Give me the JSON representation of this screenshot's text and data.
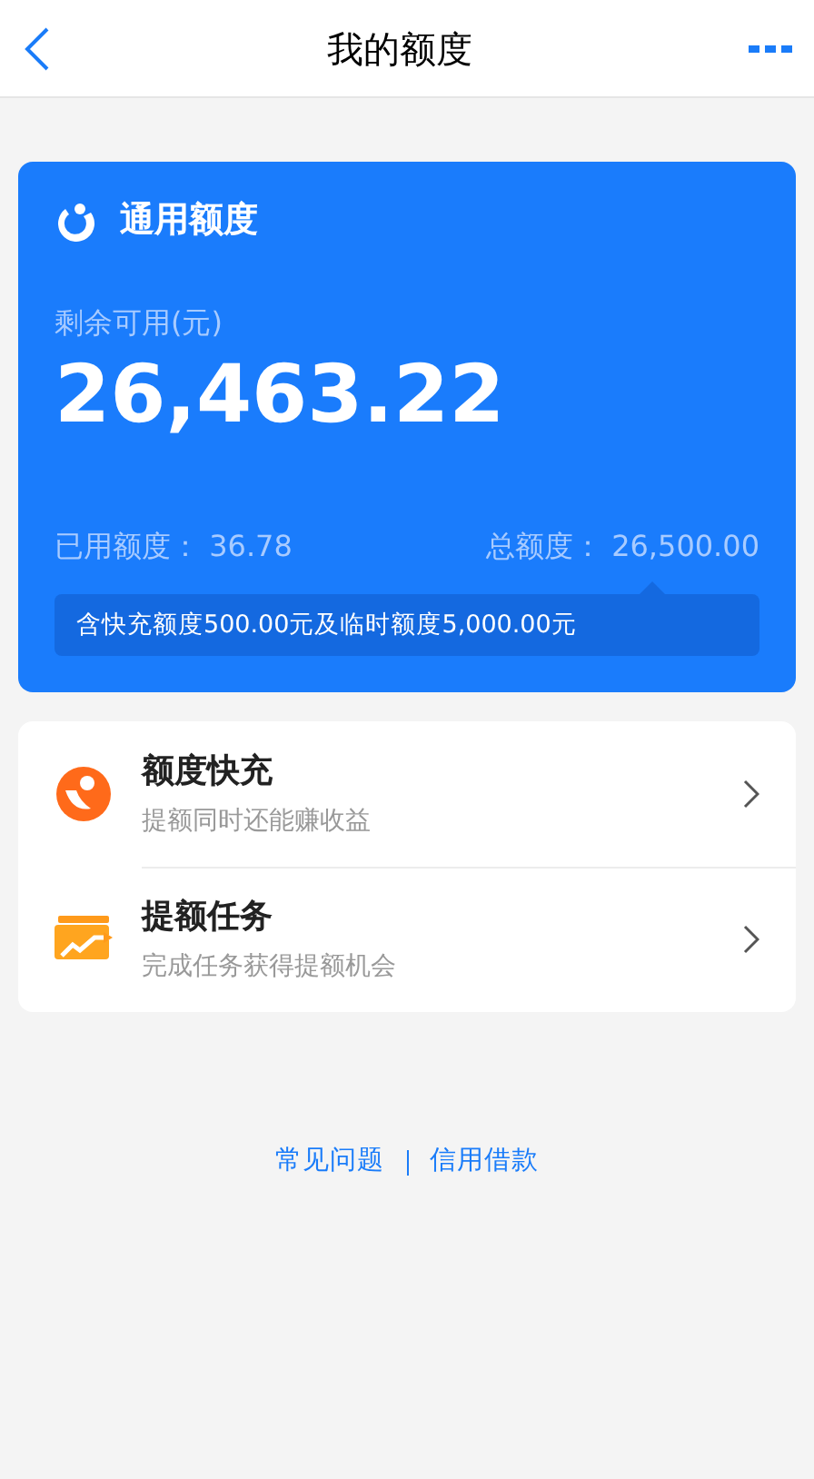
{
  "header": {
    "title": "我的额度"
  },
  "quota_card": {
    "title": "通用额度",
    "remaining_label": "剩余可用(元)",
    "remaining_amount": "26,463.22",
    "used_label": "已用额度：",
    "used_value": "36.78",
    "total_label": "总额度：",
    "total_value": "26,500.00",
    "note": "含快充额度500.00元及临时额度5,000.00元"
  },
  "menu": [
    {
      "kind": "recharge",
      "title": "额度快充",
      "subtitle": "提额同时还能赚收益"
    },
    {
      "kind": "task",
      "title": "提额任务",
      "subtitle": "完成任务获得提额机会"
    }
  ],
  "footer_links": [
    "常见问题",
    "信用借款"
  ]
}
